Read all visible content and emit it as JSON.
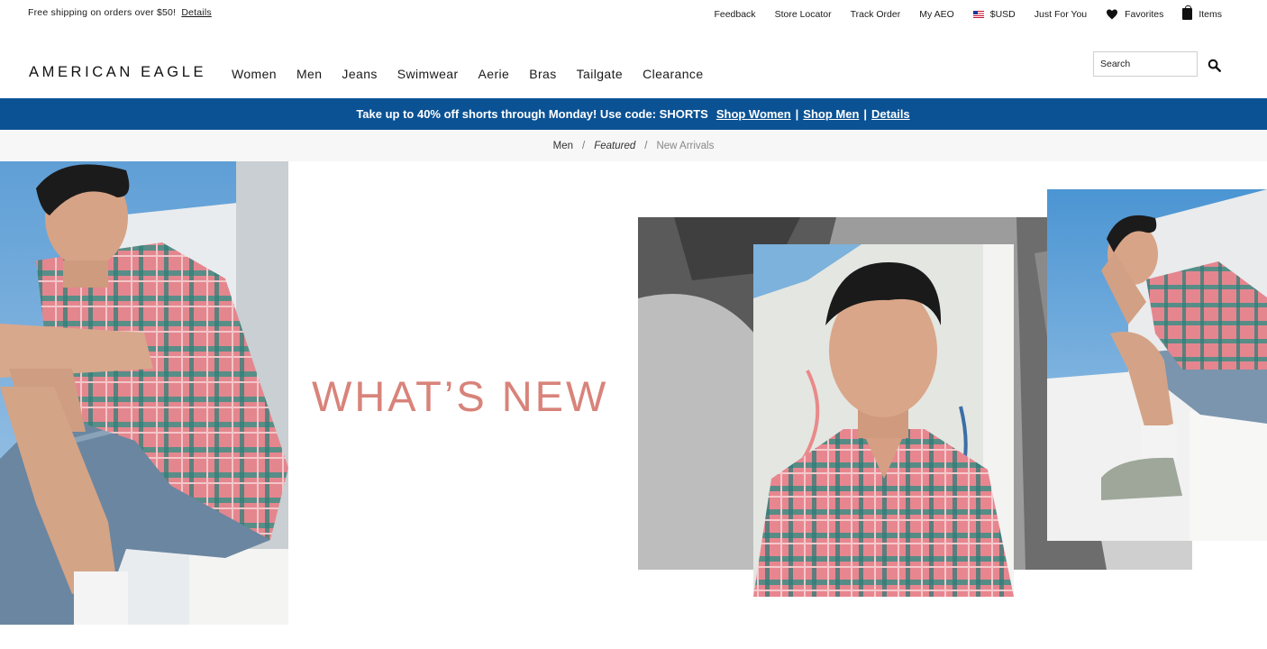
{
  "utility": {
    "shipping_text": "Free shipping on orders over $50!",
    "shipping_link": "Details",
    "links": [
      "Feedback",
      "Store Locator",
      "Track Order",
      "My AEO"
    ],
    "currency": "$USD",
    "just_for_you": "Just For You",
    "favorites": "Favorites",
    "items": "Items"
  },
  "header": {
    "logo": "AMERICAN EAGLE",
    "nav": [
      "Women",
      "Men",
      "Jeans",
      "Swimwear",
      "Aerie",
      "Bras",
      "Tailgate",
      "Clearance"
    ],
    "search_placeholder": "Search"
  },
  "promo": {
    "text": "Take up to 40% off shorts through Monday! Use code: SHORTS",
    "shop_women": "Shop Women",
    "shop_men": "Shop Men",
    "details": "Details",
    "separator": "|",
    "bg_color": "#0b5294"
  },
  "breadcrumb": {
    "items": [
      "Men",
      "Featured",
      "New Arrivals"
    ],
    "separator": "/"
  },
  "hero": {
    "headline": "WHAT’S NEW",
    "headline_color": "#d8837a"
  }
}
